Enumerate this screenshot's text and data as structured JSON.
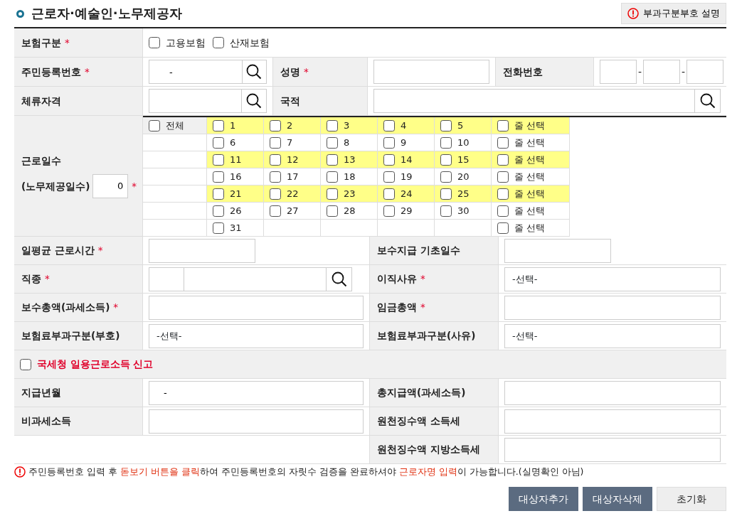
{
  "title": "근로자·예술인·노무제공자",
  "help_button": "부과구분부호 설명",
  "insurance": {
    "label": "보험구분",
    "mark": "*",
    "options": [
      {
        "label": "고용보험",
        "checked": false
      },
      {
        "label": "산재보험",
        "checked": false
      }
    ]
  },
  "resident_no": {
    "label": "주민등록번호",
    "mark": "*",
    "value": "-"
  },
  "name": {
    "label": "성명",
    "mark": "*"
  },
  "phone": {
    "label": "전화번호",
    "separators": [
      "-",
      "-"
    ]
  },
  "visa": {
    "label": "체류자격"
  },
  "nationality": {
    "label": "국적"
  },
  "work_days": {
    "label": "근로일수",
    "sublabel": "(노무제공일수)",
    "count": "0",
    "mark": "*",
    "all": {
      "label": "전체",
      "checked": false
    },
    "rows": [
      {
        "highlighted": true,
        "days": [
          {
            "label": "1",
            "checked": false
          },
          {
            "label": "2",
            "checked": false
          },
          {
            "label": "3",
            "checked": false
          },
          {
            "label": "4",
            "checked": false
          },
          {
            "label": "5",
            "checked": false
          }
        ],
        "row_select": {
          "label": "줄 선택",
          "checked": false
        }
      },
      {
        "highlighted": false,
        "days": [
          {
            "label": "6",
            "checked": false
          },
          {
            "label": "7",
            "checked": false
          },
          {
            "label": "8",
            "checked": false
          },
          {
            "label": "9",
            "checked": false
          },
          {
            "label": "10",
            "checked": false
          }
        ],
        "row_select": {
          "label": "줄 선택",
          "checked": false
        }
      },
      {
        "highlighted": true,
        "days": [
          {
            "label": "11",
            "checked": false
          },
          {
            "label": "12",
            "checked": false
          },
          {
            "label": "13",
            "checked": false
          },
          {
            "label": "14",
            "checked": false
          },
          {
            "label": "15",
            "checked": false
          }
        ],
        "row_select": {
          "label": "줄 선택",
          "checked": false
        }
      },
      {
        "highlighted": false,
        "days": [
          {
            "label": "16",
            "checked": false
          },
          {
            "label": "17",
            "checked": false
          },
          {
            "label": "18",
            "checked": false
          },
          {
            "label": "19",
            "checked": false
          },
          {
            "label": "20",
            "checked": false
          }
        ],
        "row_select": {
          "label": "줄 선택",
          "checked": false
        }
      },
      {
        "highlighted": true,
        "days": [
          {
            "label": "21",
            "checked": false
          },
          {
            "label": "22",
            "checked": false
          },
          {
            "label": "23",
            "checked": false
          },
          {
            "label": "24",
            "checked": false
          },
          {
            "label": "25",
            "checked": false
          }
        ],
        "row_select": {
          "label": "줄 선택",
          "checked": false
        }
      },
      {
        "highlighted": false,
        "days": [
          {
            "label": "26",
            "checked": false
          },
          {
            "label": "27",
            "checked": false
          },
          {
            "label": "28",
            "checked": false
          },
          {
            "label": "29",
            "checked": false
          },
          {
            "label": "30",
            "checked": false
          }
        ],
        "row_select": {
          "label": "줄 선택",
          "checked": false
        }
      },
      {
        "highlighted": false,
        "days": [
          {
            "label": "31",
            "checked": false
          }
        ],
        "row_select": {
          "label": "줄 선택",
          "checked": false
        }
      }
    ]
  },
  "detail_rows": [
    {
      "cells": [
        {
          "label": "일평균 근로시간",
          "mark": "*",
          "kind": "short_input"
        },
        {
          "label": "보수지급 기초일수",
          "kind": "short_input"
        }
      ]
    },
    {
      "cells": [
        {
          "label": "직종",
          "mark": "*",
          "kind": "code_search"
        },
        {
          "label": "이직사유",
          "mark": "*",
          "kind": "select",
          "value": "-선택-"
        }
      ]
    },
    {
      "cells": [
        {
          "label": "보수총액(과세소득)",
          "mark": "*",
          "kind": "input"
        },
        {
          "label": "임금총액",
          "mark": "*",
          "kind": "input"
        }
      ]
    },
    {
      "cells": [
        {
          "label": "보험료부과구분(부호)",
          "kind": "select",
          "value": "-선택-"
        },
        {
          "label": "보험료부과구분(사유)",
          "kind": "select",
          "value": "-선택-"
        }
      ]
    }
  ],
  "tax_report": {
    "label": "국세청 일용근로소득 신고",
    "checked": false
  },
  "tax_rows": [
    {
      "cells": [
        {
          "label": "지급년월",
          "kind": "input",
          "value": "-"
        },
        {
          "label": "총지급액(과세소득)",
          "kind": "input"
        }
      ]
    },
    {
      "cells": [
        {
          "label": "비과세소득",
          "kind": "input"
        },
        {
          "label": "원천징수액 소득세",
          "kind": "input"
        }
      ]
    },
    {
      "cells": [
        {
          "kind": "blank"
        },
        {
          "label": "원천징수액 지방소득세",
          "kind": "input"
        }
      ]
    }
  ],
  "note": [
    {
      "text": "주민등록번호 입력 후 ",
      "emphasis": false
    },
    {
      "text": "돋보기 버튼을 클릭",
      "emphasis": true
    },
    {
      "text": "하여 주민등록번호의 자릿수 검증을 완료하셔야 ",
      "emphasis": false
    },
    {
      "text": "근로자명 입력",
      "emphasis": true
    },
    {
      "text": "이 가능합니다.(실명확인 아님)",
      "emphasis": false
    }
  ],
  "buttons": [
    {
      "label": "대상자추가",
      "kind": "primary"
    },
    {
      "label": "대상자삭제",
      "kind": "primary"
    },
    {
      "label": "초기화",
      "kind": "secondary"
    }
  ]
}
